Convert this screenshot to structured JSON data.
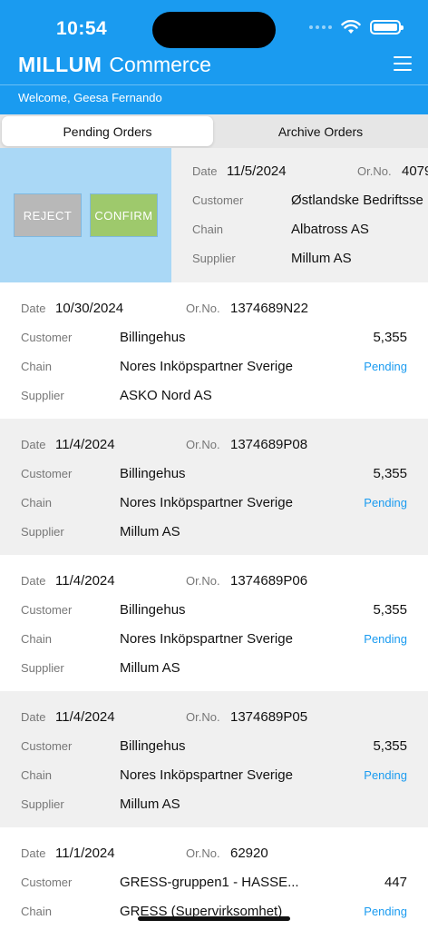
{
  "status_bar": {
    "time": "10:54"
  },
  "header": {
    "brand_main": "MILLUM",
    "brand_sub": "Commerce",
    "welcome": "Welcome, Geesa Fernando"
  },
  "tabs": [
    {
      "label": "Pending Orders",
      "active": true
    },
    {
      "label": "Archive Orders",
      "active": false
    }
  ],
  "labels": {
    "date": "Date",
    "orno": "Or.No.",
    "customer": "Customer",
    "chain": "Chain",
    "supplier": "Supplier"
  },
  "swipe_actions": {
    "reject": "REJECT",
    "confirm": "CONFIRM"
  },
  "orders": [
    {
      "date": "11/5/2024",
      "orno": "4079",
      "customer": "Østlandske Bedriftsse",
      "chain": "Albatross AS",
      "supplier": "Millum AS"
    },
    {
      "date": "10/30/2024",
      "orno": "1374689N22",
      "customer": "Billingehus",
      "amount": "5,355",
      "chain": "Nores Inköpspartner Sverige",
      "status": "Pending",
      "supplier": "ASKO Nord AS"
    },
    {
      "date": "11/4/2024",
      "orno": "1374689P08",
      "customer": "Billingehus",
      "amount": "5,355",
      "chain": "Nores Inköpspartner Sverige",
      "status": "Pending",
      "supplier": "Millum AS"
    },
    {
      "date": "11/4/2024",
      "orno": "1374689P06",
      "customer": "Billingehus",
      "amount": "5,355",
      "chain": "Nores Inköpspartner Sverige",
      "status": "Pending",
      "supplier": "Millum AS"
    },
    {
      "date": "11/4/2024",
      "orno": "1374689P05",
      "customer": "Billingehus",
      "amount": "5,355",
      "chain": "Nores Inköpspartner Sverige",
      "status": "Pending",
      "supplier": "Millum AS"
    },
    {
      "date": "11/1/2024",
      "orno": "62920",
      "customer": "GRESS-gruppen1 - HASSE...",
      "amount": "447",
      "chain": "GRESS (Supervirksomhet)",
      "status": "Pending"
    }
  ],
  "colors": {
    "accent": "#1a9bf0",
    "confirm": "#9ec96c",
    "reject": "#b8b8b8",
    "swipe_bg": "#aad8f6"
  }
}
